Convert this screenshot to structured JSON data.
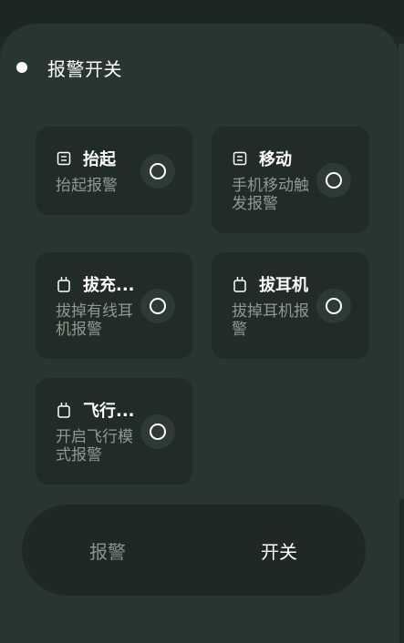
{
  "header": {
    "title": "报警开关"
  },
  "cards": [
    {
      "label": "抬起",
      "desc": "抬起报警",
      "icon": "lift-sensor-icon"
    },
    {
      "label": "移动",
      "desc": "手机移动触发报警",
      "icon": "motion-sensor-icon"
    },
    {
      "label": "拔充...",
      "desc": "拔掉有线耳机报警",
      "icon": "plug-icon"
    },
    {
      "label": "拔耳机",
      "desc": "拔掉耳机报警",
      "icon": "plug-icon"
    },
    {
      "label": "飞行...",
      "desc": "开启飞行模式报警",
      "icon": "plug-icon"
    }
  ],
  "segmented": {
    "left": "报警",
    "right": "开关"
  },
  "colors": {
    "panel": "#29362f",
    "card": "#222c27",
    "text": "#ffffff",
    "muted": "#8f9993"
  }
}
